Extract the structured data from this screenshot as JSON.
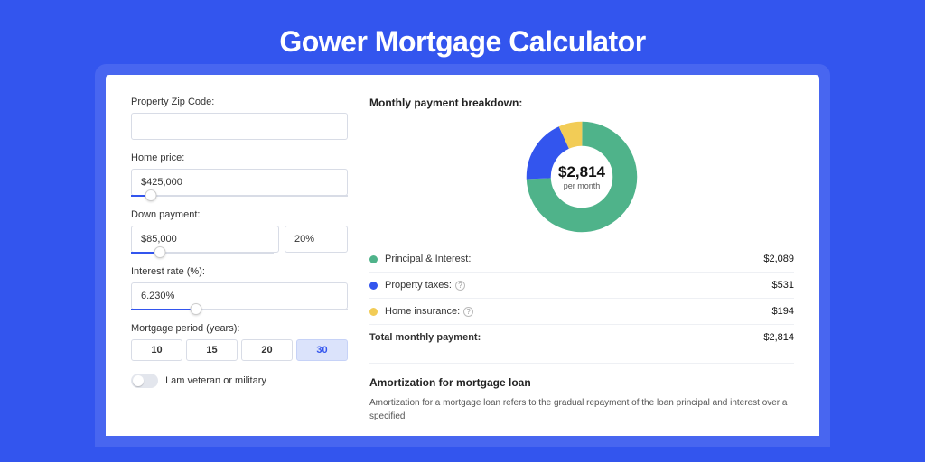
{
  "title": "Gower Mortgage Calculator",
  "form": {
    "zip_label": "Property Zip Code:",
    "zip_value": "",
    "home_price_label": "Home price:",
    "home_price_value": "$425,000",
    "home_price_slider_pct": 9,
    "down_payment_label": "Down payment:",
    "down_payment_value": "$85,000",
    "down_payment_pct_value": "20%",
    "down_payment_slider_pct": 20,
    "interest_label": "Interest rate (%):",
    "interest_value": "6.230%",
    "interest_slider_pct": 30,
    "period_label": "Mortgage period (years):",
    "period_options": [
      "10",
      "15",
      "20",
      "30"
    ],
    "period_selected_index": 3,
    "veteran_label": "I am veteran or military",
    "veteran_on": false
  },
  "breakdown": {
    "title": "Monthly payment breakdown:",
    "center_amount": "$2,814",
    "center_sub": "per month",
    "items": [
      {
        "label": "Principal & Interest:",
        "value": "$2,089",
        "color": "#4fb38a",
        "help": false
      },
      {
        "label": "Property taxes:",
        "value": "$531",
        "color": "#3355ee",
        "help": true
      },
      {
        "label": "Home insurance:",
        "value": "$194",
        "color": "#f2cc56",
        "help": true
      }
    ],
    "total_label": "Total monthly payment:",
    "total_value": "$2,814"
  },
  "amortization": {
    "title": "Amortization for mortgage loan",
    "text": "Amortization for a mortgage loan refers to the gradual repayment of the loan principal and interest over a specified"
  },
  "chart_data": {
    "type": "pie",
    "title": "Monthly payment breakdown",
    "series": [
      {
        "name": "Principal & Interest",
        "value": 2089,
        "color": "#4fb38a"
      },
      {
        "name": "Property taxes",
        "value": 531,
        "color": "#3355ee"
      },
      {
        "name": "Home insurance",
        "value": 194,
        "color": "#f2cc56"
      }
    ],
    "total": 2814,
    "unit": "USD per month"
  }
}
